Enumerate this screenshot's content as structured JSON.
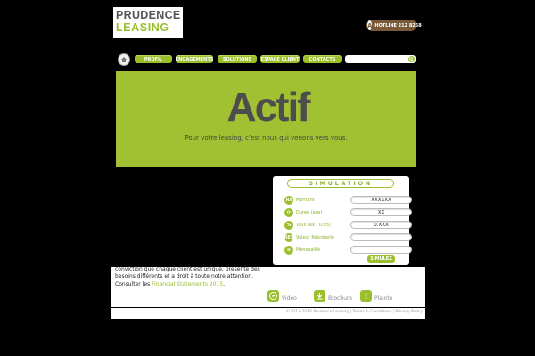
{
  "logo": {
    "line1": "PRUDENCE",
    "line2": "LEASING"
  },
  "hotline": {
    "icon": "A",
    "text": "HOTLINE 212 8258"
  },
  "nav": {
    "items": [
      "PROFIL",
      "ENGAGEMENTS",
      "SOLUTIONS",
      "ESPACE CLIENT",
      "CONTACTS"
    ],
    "search_placeholder": ""
  },
  "banner": {
    "title": "Actif",
    "subtitle": "Pour votre leasing, c’est nous qui venons vers vous."
  },
  "simulation": {
    "title": "SIMULATION",
    "rows": [
      {
        "icon": "Rs",
        "label": "Montant",
        "value": "XXXXXX"
      },
      {
        "icon": "⟳",
        "label": "Durée (ans)",
        "value": "XX"
      },
      {
        "icon": "%",
        "label": "Taux  (ex : 0.05)",
        "value": "0.XXX"
      },
      {
        "icon": "RES",
        "label": "Valeur Résiduelle",
        "value": ""
      },
      {
        "icon": "≡",
        "label": "Mensualité",
        "value": ""
      }
    ],
    "submit": "SIMULEZ"
  },
  "content": {
    "line1": "conviction que chaque client est unique, présente des",
    "line2": "besoins différents et a droit à toute notre attention.",
    "consult_prefix": "Consulter les ",
    "consult_link": "Financial Statements 2015",
    "consult_suffix": "."
  },
  "actions": [
    {
      "icon": "play-icon",
      "label": "Video"
    },
    {
      "icon": "download-icon",
      "label": "Brochure"
    },
    {
      "icon": "exclamation-icon",
      "label": "Plainte"
    }
  ],
  "footer": {
    "text": "©2012-2016 Prudence Leasing | Terms & Conditions | Privacy Policy"
  },
  "colors": {
    "accent": "#9bbf2c",
    "banner": "#a2c132",
    "hotline": "#7a5a3a"
  }
}
